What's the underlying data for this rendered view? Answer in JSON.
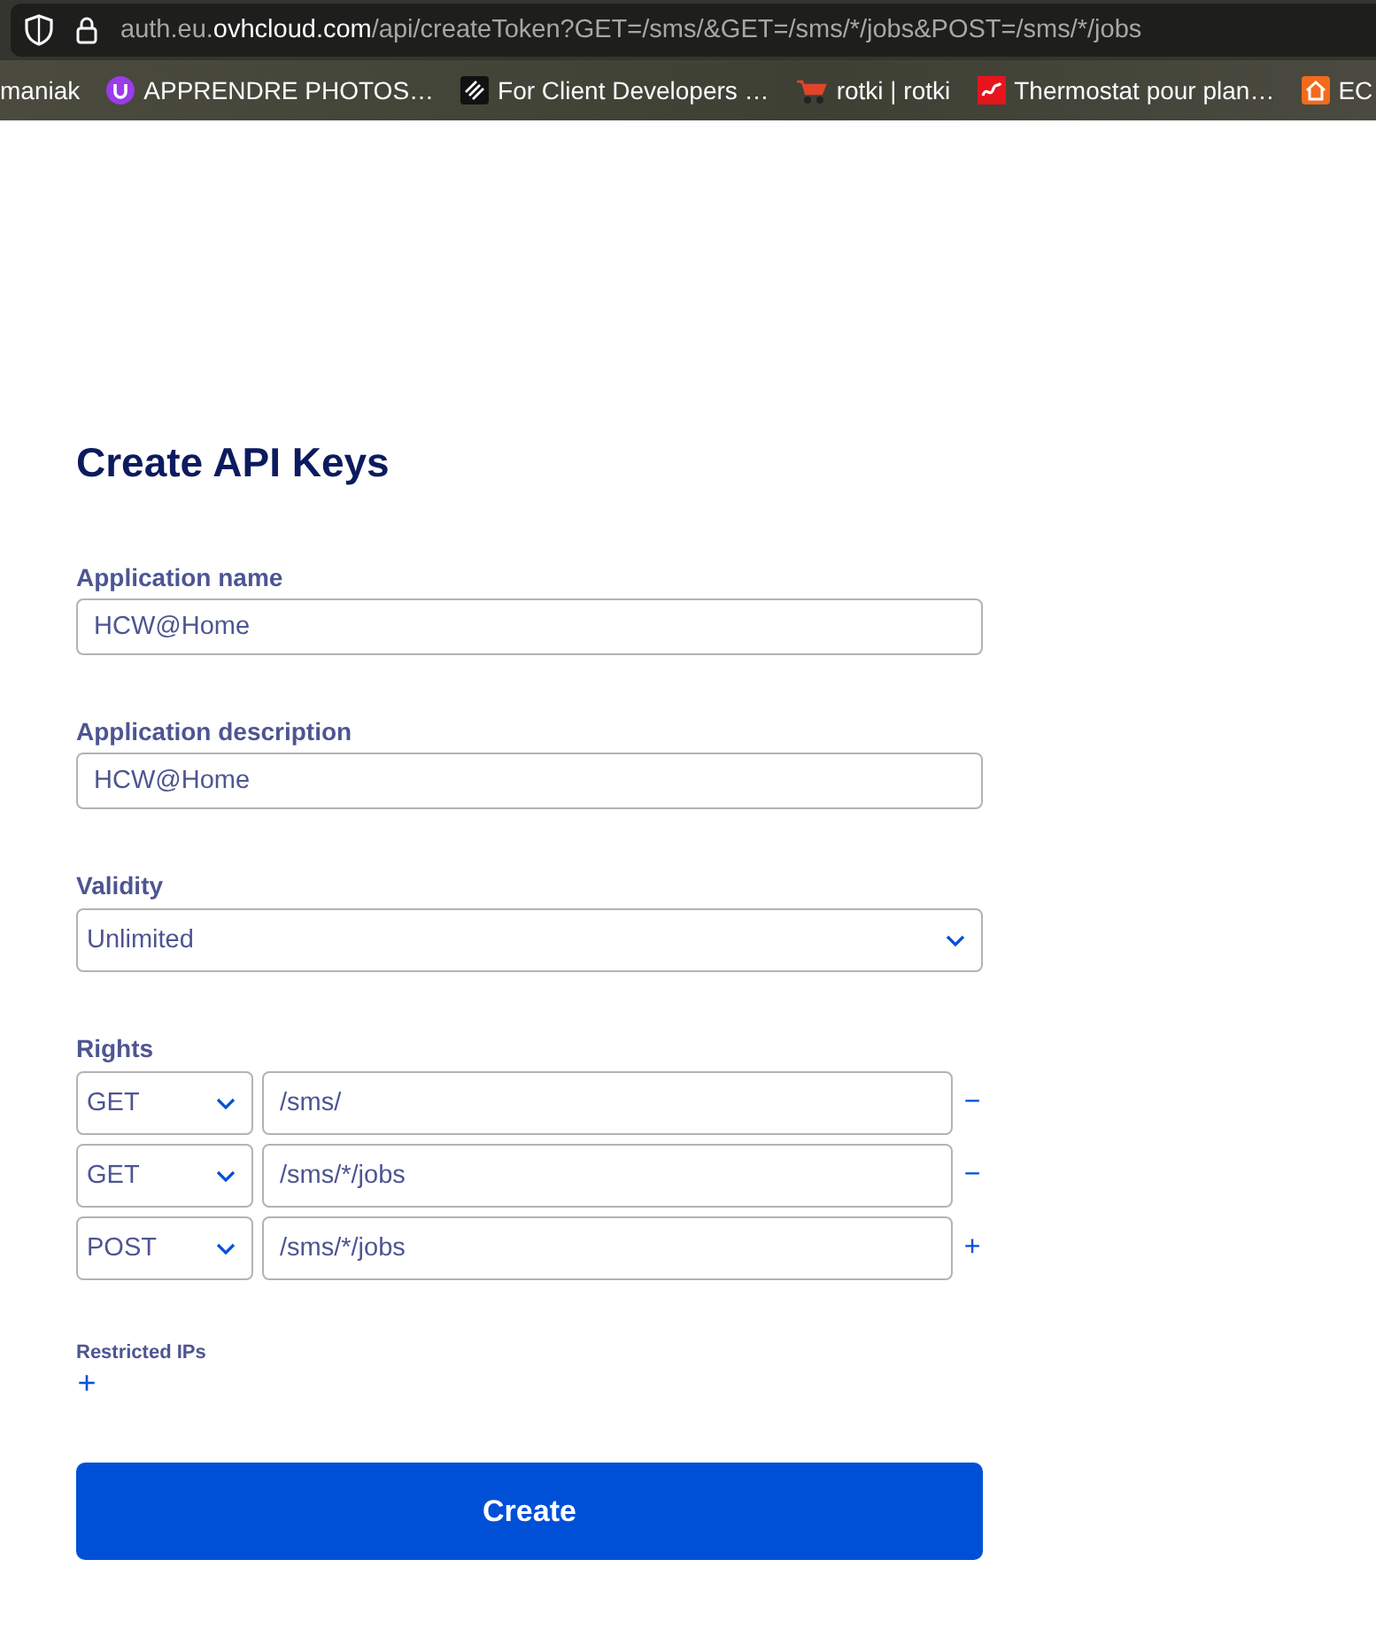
{
  "browser": {
    "url": {
      "subdomain": "auth.eu.",
      "domain": "ovhcloud.com",
      "path": "/api/createToken?GET=/sms/&GET=/sms/*/jobs&POST=/sms/*/jobs"
    },
    "bookmarks": [
      {
        "label": "maniak"
      },
      {
        "label": "APPRENDRE PHOTOS…"
      },
      {
        "label": "For Client Developers …"
      },
      {
        "label": "rotki | rotki"
      },
      {
        "label": "Thermostat pour plan…"
      },
      {
        "label": "EC"
      }
    ]
  },
  "form": {
    "title": "Create API Keys",
    "fields": [
      {
        "kind": "text",
        "label": "Application name",
        "value": "HCW@Home"
      },
      {
        "kind": "text",
        "label": "Application description",
        "value": "HCW@Home"
      },
      {
        "kind": "select",
        "label": "Validity",
        "value": "Unlimited"
      }
    ],
    "rights": {
      "label": "Rights",
      "rows": [
        {
          "method": "GET",
          "path": "/sms/",
          "action": "−"
        },
        {
          "method": "GET",
          "path": "/sms/*/jobs",
          "action": "−"
        },
        {
          "method": "POST",
          "path": "/sms/*/jobs",
          "action": "+"
        }
      ]
    },
    "restricted_ips": {
      "label": "Restricted IPs",
      "add": "+"
    },
    "submit": "Create"
  }
}
